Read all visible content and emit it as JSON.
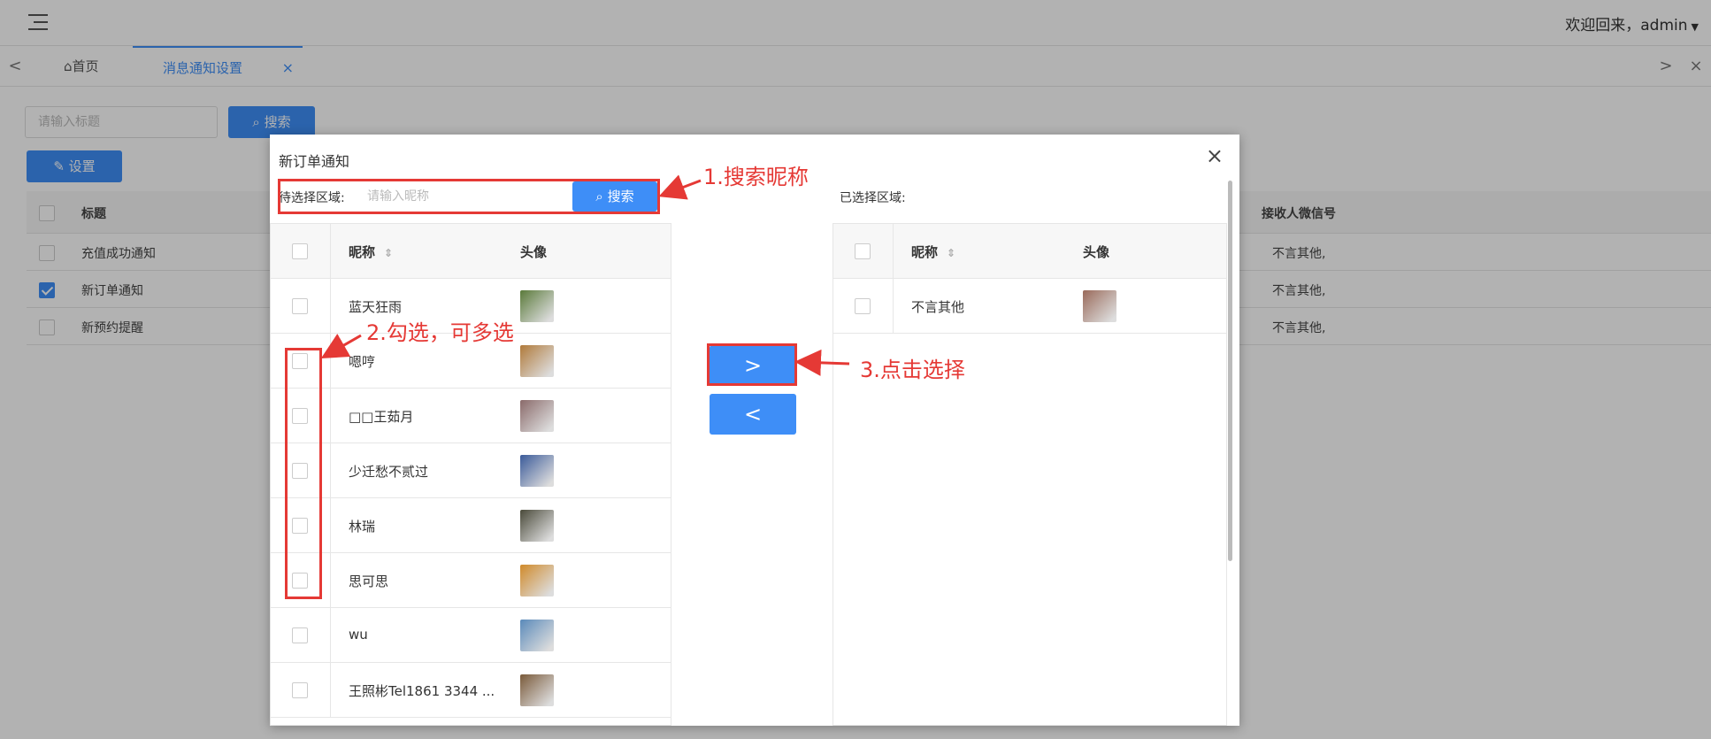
{
  "header": {
    "welcome": "欢迎回来，admin"
  },
  "tabs": {
    "home": "首页",
    "active": "消息通知设置",
    "close": "×"
  },
  "toolbar": {
    "search_placeholder": "请输入标题",
    "search_label": "搜索",
    "set_label": "设置"
  },
  "table": {
    "col_title": "标题",
    "col_wechat": "接收人微信号",
    "rows": [
      {
        "title": "充值成功通知",
        "wechat": "不言其他,",
        "checked": false
      },
      {
        "title": "新订单通知",
        "wechat": "不言其他,",
        "checked": true
      },
      {
        "title": "新预约提醒",
        "wechat": "不言其他,",
        "checked": false
      }
    ]
  },
  "modal": {
    "title": "新订单通知",
    "close": "×",
    "left_label": "待选择区域:",
    "left_placeholder": "请输入昵称",
    "left_search": "搜索",
    "right_label": "已选择区域:",
    "col_nick": "昵称",
    "col_avatar": "头像",
    "move_right": ">",
    "move_left": "<",
    "candidates": [
      {
        "nick": "蓝天狂雨",
        "avatar_color": "#5a7a3a"
      },
      {
        "nick": "嗯哼",
        "avatar_color": "#b07a3a"
      },
      {
        "nick": "□□王茹月",
        "avatar_color": "#8a6a6a"
      },
      {
        "nick": "少迁愁不贰过",
        "avatar_color": "#3a5a9a"
      },
      {
        "nick": "林瑞",
        "avatar_color": "#4a4a3a"
      },
      {
        "nick": "思可思",
        "avatar_color": "#d08a2a"
      },
      {
        "nick": "wu",
        "avatar_color": "#5a8aba"
      },
      {
        "nick": "王照彬Tel1861 3344 ...",
        "avatar_color": "#7a5a3a"
      }
    ],
    "selected": [
      {
        "nick": "不言其他",
        "avatar_color": "#9a6a5a"
      }
    ]
  },
  "annotations": {
    "step1": "1.搜索昵称",
    "step2": "2.勾选，可多选",
    "step3": "3.点击选择"
  },
  "colors": {
    "accent": "#3e8ef7",
    "annotation": "#e53935"
  },
  "icons": {
    "menu": "menu-icon",
    "home": "home-icon",
    "search": "search-icon",
    "pen": "pen-icon",
    "sort": "sort-icon",
    "close": "close-icon"
  }
}
